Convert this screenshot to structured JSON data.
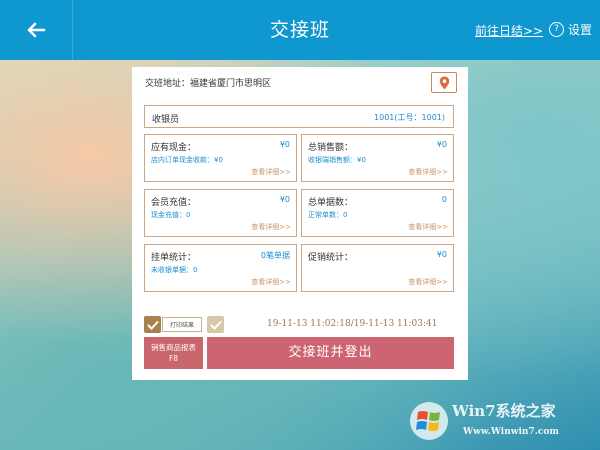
{
  "header": {
    "title": "交接班",
    "summary_link": "前往日结>>",
    "settings_label": "设置",
    "settings_glyph": "?"
  },
  "address": {
    "label": "交班地址：福建省厦门市思明区"
  },
  "cashier": {
    "label": "收银员",
    "value": "1001(工号：1001)"
  },
  "stats": [
    {
      "label": "应有现金：",
      "value": "¥0",
      "sub": "店内订单现金收款：¥0",
      "more": "查看详细>>"
    },
    {
      "label": "总销售额：",
      "value": "¥0",
      "sub": "收银端销售额：¥0",
      "more": "查看详细>>"
    },
    {
      "label": "会员充值：",
      "value": "¥0",
      "sub": "现金充值：0",
      "more": "查看详细>>"
    },
    {
      "label": "总单据数：",
      "value": "0",
      "sub": "正常单数：0",
      "more": "查看详细>>"
    },
    {
      "label": "挂单统计：",
      "value": "0笔单据",
      "sub": "未收银单据：0",
      "more": "查看详细>>"
    },
    {
      "label": "促销统计：",
      "value": "¥0",
      "sub": "",
      "more": "查看详细>>"
    }
  ],
  "footer": {
    "print_label": "打印结果",
    "timestamp": "19-11-13 11:02:18/19-11-13 11:03:41",
    "report_button_line1": "销售商品报表",
    "report_button_line2": "F8",
    "logout_button": "交接班并登出"
  },
  "watermark": {
    "brand": "Win7系统之家",
    "url": "Www.Winwin7.com"
  },
  "colors": {
    "topbar": "#0f97cf",
    "accent_blue": "#1a8fd1",
    "border_brown": "#c9a787",
    "primary_button": "#cc6472",
    "checkbox_checked": "#a8824c"
  }
}
